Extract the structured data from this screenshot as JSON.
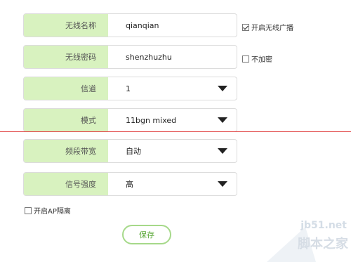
{
  "form": {
    "fields": [
      {
        "label": "无线名称",
        "value": "qianqian"
      },
      {
        "label": "无线密码",
        "value": "shenzhuzhu"
      },
      {
        "label": "信道",
        "value": "1"
      },
      {
        "label": "模式",
        "value": "11bgn mixed"
      },
      {
        "label": "频段带宽",
        "value": "自动"
      },
      {
        "label": "信号强度",
        "value": "高"
      }
    ],
    "checks": {
      "broadcast": {
        "label": "开启无线广播",
        "checked": true
      },
      "no_encrypt": {
        "label": "不加密",
        "checked": false
      },
      "ap_isolation": {
        "label": "开启AP隔离",
        "checked": false
      }
    },
    "save_label": "保存"
  },
  "watermark": {
    "site": "jb51.net",
    "name": "脚本之家"
  },
  "colors": {
    "label_bg": "#d8f2bf",
    "accent_green": "#5aa836",
    "divider_red": "#e24a4a"
  }
}
